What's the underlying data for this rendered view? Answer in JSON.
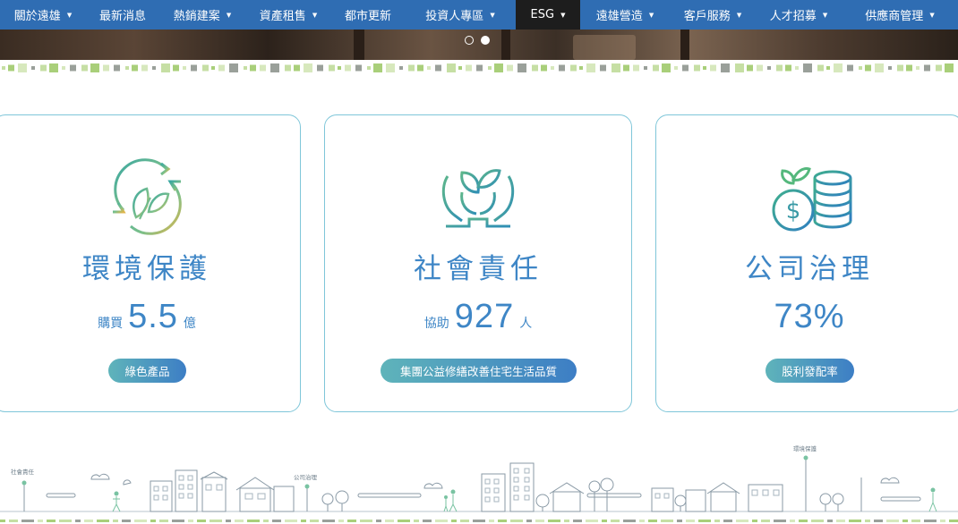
{
  "nav": {
    "items": [
      {
        "label": "關於遠雄",
        "caret": true
      },
      {
        "label": "最新消息",
        "caret": false
      },
      {
        "label": "熱銷建案",
        "caret": true
      },
      {
        "label": "資產租售",
        "caret": true
      },
      {
        "label": "都市更新",
        "caret": false
      },
      {
        "label": "投資人專區",
        "caret": true
      },
      {
        "label": "ESG",
        "caret": true,
        "active": true
      },
      {
        "label": "遠雄營造",
        "caret": true
      },
      {
        "label": "客戶服務",
        "caret": true
      },
      {
        "label": "人才招募",
        "caret": true
      },
      {
        "label": "供應商管理",
        "caret": true
      }
    ],
    "caret_glyph": "▼"
  },
  "slider": {
    "dots": 2,
    "active_index": 1
  },
  "colors": {
    "nav_bg": "#2f6db3",
    "nav_active": "#1d1d1d",
    "accent_blue": "#3e86c6",
    "card_border": "#7fc6d9",
    "pill_start": "#5fb4ba",
    "pill_end": "#3d7ec5",
    "deco_green": "#a9cf7a",
    "deco_light": "#d7e8bd",
    "deco_gray": "#9aa09a"
  },
  "cards": [
    {
      "icon": "recycle-leaf-icon",
      "title": "環境保護",
      "stat_prefix": "購買",
      "stat_value": "5.5",
      "stat_suffix": "億",
      "button": "綠色產品"
    },
    {
      "icon": "hands-sprout-icon",
      "title": "社會責任",
      "stat_prefix": "協助",
      "stat_value": "927",
      "stat_suffix": "人",
      "button": "集團公益修繕改善住宅生活品質"
    },
    {
      "icon": "coin-sprout-icon",
      "title": "公司治理",
      "stat_prefix": "",
      "stat_value": "73%",
      "stat_suffix": "",
      "button": "股利發配率"
    }
  ],
  "city": {
    "labels": [
      "社會責任",
      "公司治理",
      "環境保護"
    ]
  }
}
